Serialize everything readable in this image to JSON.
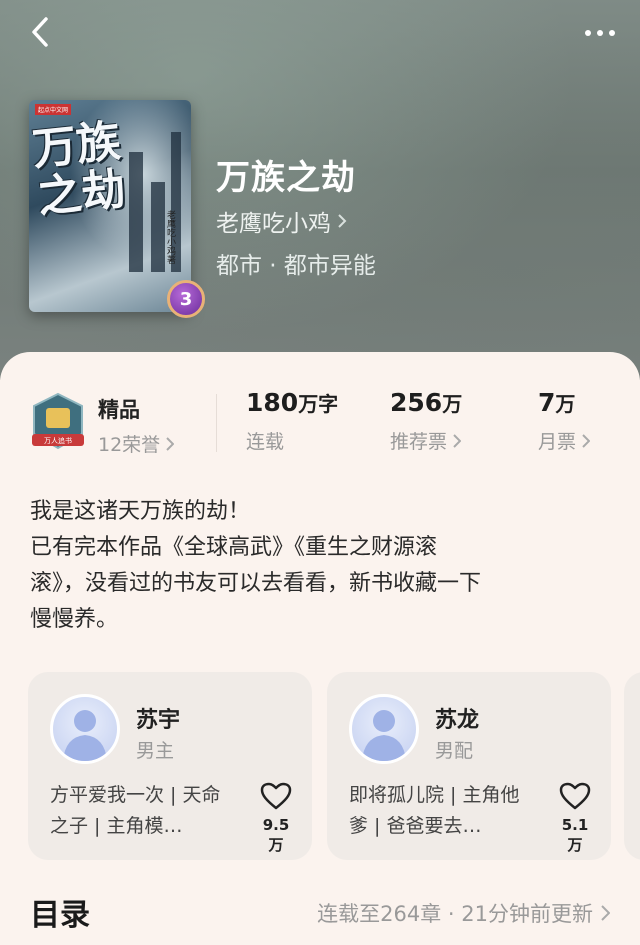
{
  "header": {
    "title": "万族之劫",
    "author": "老鹰吃小鸡",
    "genre": "都市 · 都市异能",
    "cover": {
      "title_text": "万族之劫",
      "author_text": "老鹰吃小鸡著",
      "tag": "起点中文网",
      "badge": "3"
    }
  },
  "stats": {
    "honor": {
      "label": "精品",
      "sub": "12荣誉",
      "emblem_text": "万人追书"
    },
    "words": {
      "num": "180",
      "unit": "万字",
      "label": "连载"
    },
    "recommend": {
      "num": "256",
      "unit": "万",
      "label": "推荐票"
    },
    "monthly": {
      "num": "7",
      "unit": "万",
      "label": "月票"
    }
  },
  "synopsis": "我是这诸天万族的劫！\n已有完本作品《全球高武》《重生之财源滚\n滚》，没看过的书友可以去看看，新书收藏一下\n慢慢养。",
  "characters": [
    {
      "name": "苏宇",
      "role": "男主",
      "desc": "方平爱我一次 | 天命之子 | 主角模…",
      "likes": "9.5万"
    },
    {
      "name": "苏龙",
      "role": "男配",
      "desc": "即将孤儿院 | 主角他爹 | 爸爸要去…",
      "likes": "5.1万"
    }
  ],
  "toc": {
    "title": "目录",
    "status": "连载至264章 · 21分钟前更新"
  },
  "colors": {
    "accent_text": "#1e1e1e",
    "muted": "#999999",
    "sheet": "#fbf3ee",
    "card": "#f0ebe7"
  },
  "icons": [
    "back-arrow-icon",
    "more-dots-icon",
    "chevron-right-icon",
    "heart-icon",
    "honor-emblem-icon",
    "avatar-silhouette-icon"
  ]
}
